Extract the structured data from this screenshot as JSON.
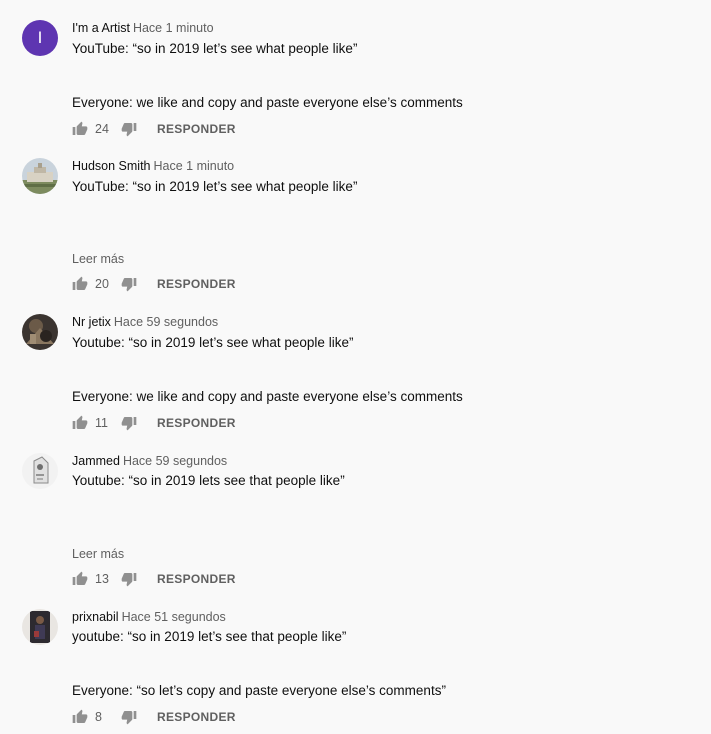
{
  "comments": [
    {
      "author": "I'm a Artist",
      "time": "Hace 1 minuto",
      "avatar_letter": "I",
      "lines": [
        "YouTube: “so in 2019 let’s see what people like”",
        "Everyone: we like and copy and paste everyone else’s comments"
      ],
      "read_more": "",
      "likes": "24",
      "reply": "RESPONDER"
    },
    {
      "author": "Hudson Smith",
      "time": "Hace 1 minuto",
      "lines": [
        "YouTube: “so in 2019 let’s see what people like”"
      ],
      "read_more": "Leer más",
      "likes": "20",
      "reply": "RESPONDER"
    },
    {
      "author": "Nr jetix",
      "time": "Hace 59 segundos",
      "lines": [
        "Youtube: “so in 2019 let’s see what people like”",
        "Everyone: we like and copy and paste everyone else’s comments"
      ],
      "read_more": "",
      "likes": "11",
      "reply": "RESPONDER"
    },
    {
      "author": "Jammed",
      "time": "Hace 59 segundos",
      "lines": [
        "Youtube: “so in 2019 lets see that people like”"
      ],
      "read_more": "Leer más",
      "likes": "13",
      "reply": "RESPONDER"
    },
    {
      "author": "prixnabil",
      "time": "Hace 51 segundos",
      "lines": [
        "youtube: “so in 2019 let’s see that people like”",
        "Everyone: “so let’s copy and paste everyone else’s comments”"
      ],
      "read_more": "",
      "likes": "8",
      "reply": "RESPONDER"
    }
  ],
  "icons": {
    "like": "thumbs-up-icon",
    "dislike": "thumbs-down-icon"
  },
  "colors": {
    "avatar_letter_bg": "#5e35b1",
    "secondary_text": "#606060"
  }
}
